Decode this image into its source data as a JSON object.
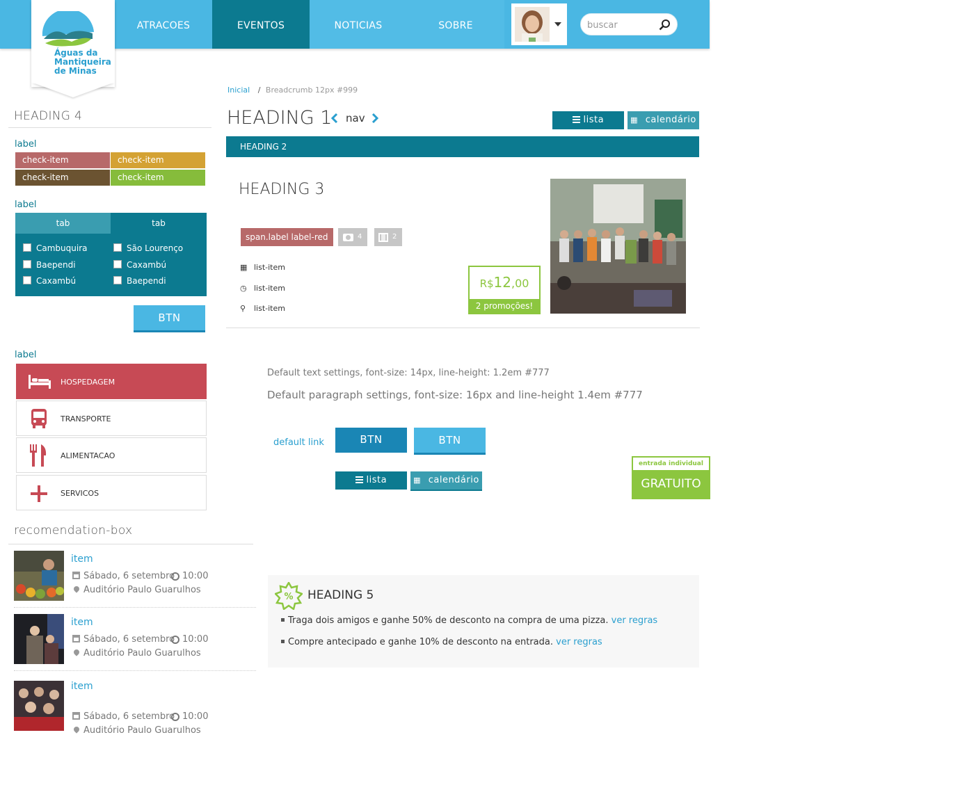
{
  "nav": {
    "items": [
      {
        "label": "ATRACOES",
        "active": false
      },
      {
        "label": "EVENTOS",
        "active": true
      },
      {
        "label": "NOTICIAS",
        "active": false
      },
      {
        "label": "SOBRE",
        "active": false
      }
    ],
    "logo_text": [
      "Águas da",
      "Mantiqueira",
      "de Minas"
    ],
    "search_placeholder": "buscar"
  },
  "sidebar": {
    "heading4": "HEADING 4",
    "label1": "label",
    "check_items": [
      {
        "label": "check-item",
        "color": "#b76969"
      },
      {
        "label": "check-item",
        "color": "#d4a234"
      },
      {
        "label": "check-item",
        "color": "#6b5331"
      },
      {
        "label": "check-item",
        "color": "#86bc3b"
      }
    ],
    "label2": "label",
    "tabs": [
      "tab",
      "tab"
    ],
    "checkboxes": [
      [
        "Cambuquira",
        "São Lourenço"
      ],
      [
        "Baependi",
        "Caxambú"
      ],
      [
        "Caxambú",
        "Baependi"
      ]
    ],
    "btn": "BTN",
    "label3": "label",
    "categories": [
      {
        "label": "HOSPEDAGEM",
        "icon": "bed-icon",
        "active": true
      },
      {
        "label": "TRANSPORTE",
        "icon": "bus-icon",
        "active": false
      },
      {
        "label": "ALIMENTACAO",
        "icon": "cutlery-icon",
        "active": false
      },
      {
        "label": "SERVICOS",
        "icon": "plus-icon",
        "active": false
      }
    ],
    "rec_title": "recomendation-box",
    "rec_items": [
      {
        "title": "item",
        "date": "Sábado, 6 setembro",
        "time": "10:00",
        "place": "Auditório Paulo Guarulhos"
      },
      {
        "title": "item",
        "date": "Sábado, 6 setembro",
        "time": "10:00",
        "place": "Auditório Paulo Guarulhos"
      },
      {
        "title": "item",
        "date": "Sábado, 6 setembro",
        "time": "10:00",
        "place": "Auditório Paulo Guarulhos"
      }
    ]
  },
  "main": {
    "breadcrumb_home": "Inicial",
    "breadcrumb_current": "Breadcrumb 12px #999",
    "heading1": "HEADING 1",
    "nav_label": "nav",
    "view_list": "lista",
    "view_calendar": "calendário",
    "heading2": "HEADING 2",
    "heading3": "HEADING 3",
    "label_red": "span.label label-red",
    "photo_count": "4",
    "video_count": "2",
    "list_items": [
      "list-item",
      "list-item",
      "list-item"
    ],
    "price_currency": "R$",
    "price_int": "12",
    "price_dec": ",00",
    "price_promo": "2 promoções!",
    "text14": "Default text settings, font-size: 14px, line-height: 1.2em #777",
    "text16": "Default paragraph settings, font-size: 16px and line-height 1.4em #777",
    "default_link": "default link",
    "btn1": "BTN",
    "btn2": "BTN",
    "view_list2": "lista",
    "view_calendar2": "calendário",
    "gratis_top": "entrada individual",
    "gratis": "GRATUITO",
    "heading5": "HEADING 5",
    "promos": [
      {
        "text": "Traga dois amigos e ganhe 50% de desconto na compra de uma pizza.",
        "link": "ver regras"
      },
      {
        "text": "Compre antecipado e ganhe 10% de desconto na entrada.",
        "link": "ver regras"
      }
    ]
  },
  "colors": {
    "brand": "#4ab7e3",
    "teal": "#0c7a90",
    "green": "#8cc63f",
    "red": "#c74a55"
  }
}
